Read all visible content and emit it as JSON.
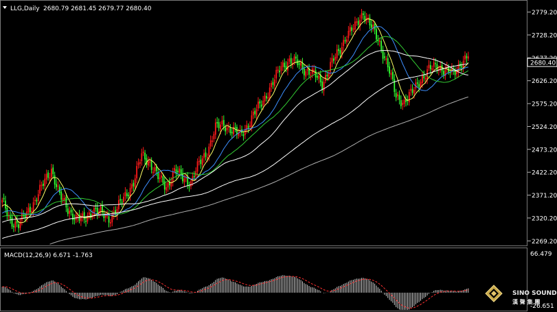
{
  "header": {
    "symbol": "LLG,Daily",
    "ohlc": "2680.79 2681.45 2679.77 2680.40"
  },
  "macd_header": "MACD(12,26,9) 6.671 -1.763",
  "current_price_label": "2680.40",
  "price_axis_labels": [
    "2779.20",
    "2728.20",
    "2677.20",
    "2626.20",
    "2575.20",
    "2524.20",
    "2473.20",
    "2422.20",
    "2371.20",
    "2320.20",
    "2269.20"
  ],
  "macd_axis_labels": {
    "top": "66.479",
    "bottom": "-26.651"
  },
  "logo": {
    "line1": "SINO SOUND",
    "line2": "漢 聲 集 團"
  },
  "colors": {
    "background": "#000000",
    "bull": "#ff1a1a",
    "bear": "#33ff33",
    "ma_fast": "#ffff66",
    "ma_blue": "#3d8fff",
    "ma_green": "#33cc33",
    "ma_white": "#ffffff",
    "ma_gray": "#b0b0b0",
    "macd_bar": "#cfcfcf",
    "signal": "#ff3030",
    "grid": "#404040"
  },
  "chart_data": [
    {
      "type": "candlestick",
      "title": "LLG,Daily",
      "ylim": [
        2262,
        2800
      ],
      "y_ticks": [
        2269.2,
        2320.2,
        2371.2,
        2422.2,
        2473.2,
        2524.2,
        2575.2,
        2626.2,
        2677.2,
        2728.2,
        2779.2
      ],
      "last_close": 2680.4,
      "close_anchors": [
        [
          0,
          2355
        ],
        [
          5,
          2315
        ],
        [
          10,
          2305
        ],
        [
          15,
          2330
        ],
        [
          20,
          2360
        ],
        [
          25,
          2395
        ],
        [
          30,
          2430
        ],
        [
          35,
          2370
        ],
        [
          40,
          2340
        ],
        [
          45,
          2320
        ],
        [
          50,
          2315
        ],
        [
          55,
          2340
        ],
        [
          60,
          2330
        ],
        [
          65,
          2320
        ],
        [
          70,
          2340
        ],
        [
          75,
          2370
        ],
        [
          80,
          2400
        ],
        [
          85,
          2460
        ],
        [
          90,
          2445
        ],
        [
          95,
          2410
        ],
        [
          100,
          2390
        ],
        [
          105,
          2425
        ],
        [
          110,
          2410
        ],
        [
          115,
          2400
        ],
        [
          120,
          2440
        ],
        [
          125,
          2470
        ],
        [
          130,
          2520
        ],
        [
          135,
          2530
        ],
        [
          140,
          2515
        ],
        [
          145,
          2505
        ],
        [
          150,
          2530
        ],
        [
          155,
          2560
        ],
        [
          160,
          2590
        ],
        [
          165,
          2620
        ],
        [
          170,
          2660
        ],
        [
          175,
          2670
        ],
        [
          180,
          2665
        ],
        [
          185,
          2650
        ],
        [
          190,
          2640
        ],
        [
          195,
          2620
        ],
        [
          200,
          2660
        ],
        [
          205,
          2690
        ],
        [
          210,
          2730
        ],
        [
          215,
          2745
        ],
        [
          220,
          2780
        ],
        [
          225,
          2745
        ],
        [
          230,
          2710
        ],
        [
          235,
          2660
        ],
        [
          240,
          2590
        ],
        [
          245,
          2580
        ],
        [
          250,
          2600
        ],
        [
          255,
          2630
        ],
        [
          260,
          2650
        ],
        [
          265,
          2660
        ],
        [
          270,
          2650
        ],
        [
          275,
          2640
        ],
        [
          280,
          2670
        ],
        [
          284,
          2680.4
        ]
      ],
      "moving_averages": [
        {
          "color": "ma_fast",
          "period": 8
        },
        {
          "color": "ma_blue",
          "period": 21
        },
        {
          "color": "ma_green",
          "period": 34
        },
        {
          "color": "ma_white",
          "period": 55
        },
        {
          "color": "ma_white",
          "period": 120
        },
        {
          "color": "ma_gray",
          "period": 200
        }
      ]
    },
    {
      "type": "bar",
      "title": "MACD(12,26,9)",
      "macd": 6.671,
      "signal": -1.763,
      "ylim": [
        -26.651,
        66.479
      ]
    }
  ]
}
